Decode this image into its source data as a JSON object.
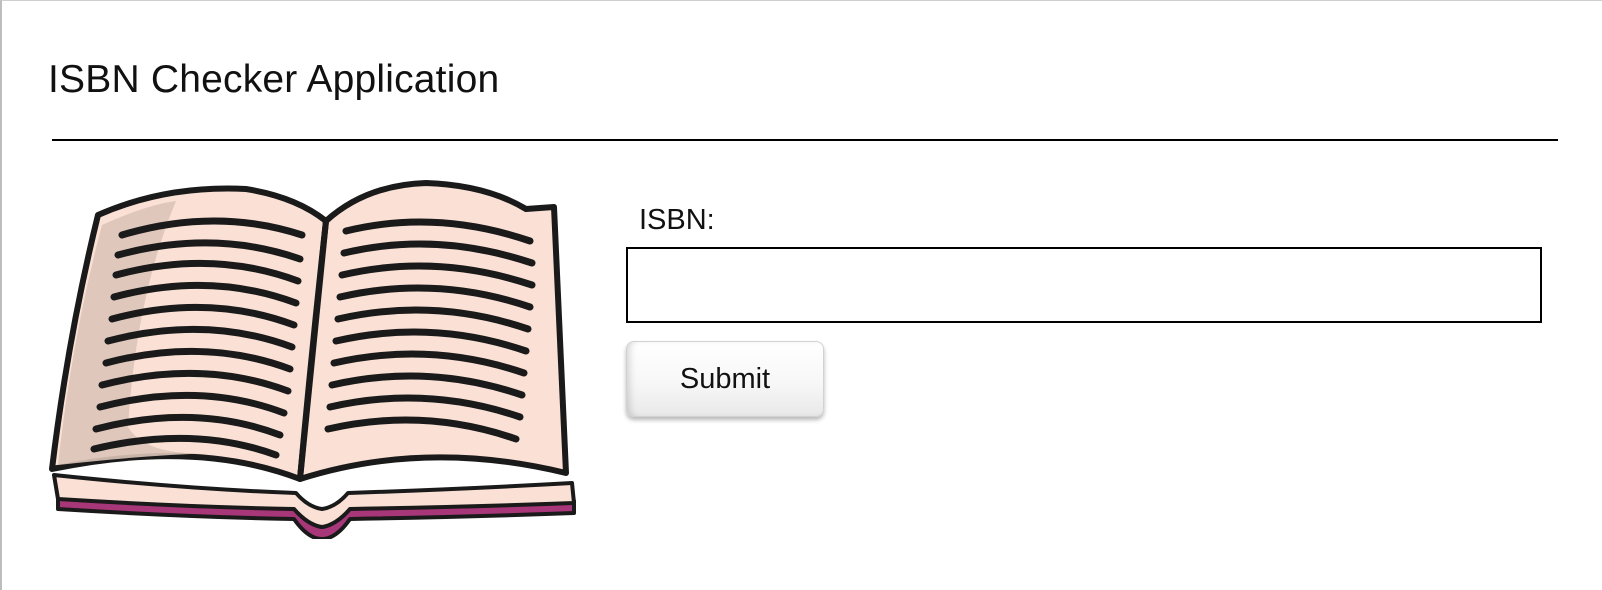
{
  "app": {
    "title": "ISBN Checker Application"
  },
  "form": {
    "isbn_label": "ISBN:",
    "isbn_value": "",
    "submit_label": "Submit"
  },
  "illustration": {
    "icon": "open-book-icon"
  },
  "colors": {
    "page_fill": "#fbe1d5",
    "page_shadow": "#dcc4b8",
    "cover_edge": "#a8377a",
    "outline": "#1a1a1a"
  }
}
